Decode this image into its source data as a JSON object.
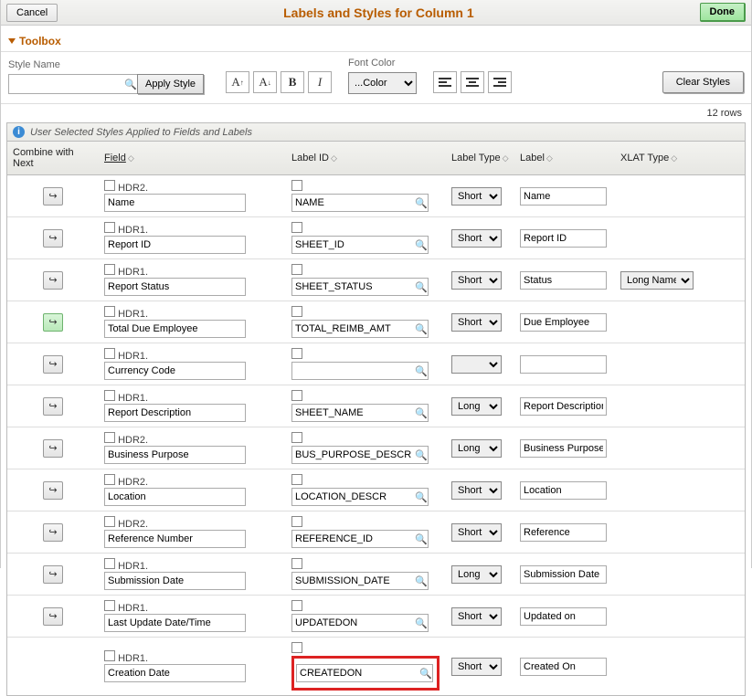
{
  "header": {
    "cancel": "Cancel",
    "title": "Labels and Styles for Column 1",
    "done": "Done"
  },
  "toolbox": {
    "title": "Toolbox",
    "style_name_label": "Style Name",
    "style_name_value": "",
    "apply_style": "Apply Style",
    "font_color_label": "Font Color",
    "font_color_value": "...Color",
    "clear_styles": "Clear Styles"
  },
  "row_count": "12 rows",
  "banner": "User Selected Styles Applied to Fields and Labels",
  "columns": {
    "combine": "Combine with Next",
    "field": "Field",
    "label_id": "Label ID",
    "label_type": "Label Type",
    "label": "Label",
    "xlat": "XLAT Type"
  },
  "rows": [
    {
      "hl": false,
      "hdr": "HDR2.",
      "field": "Name",
      "label_id": "NAME",
      "label_type": "Short",
      "label": "Name",
      "xlat": "",
      "highlight": false
    },
    {
      "hl": false,
      "hdr": "HDR1.",
      "field": "Report ID",
      "label_id": "SHEET_ID",
      "label_type": "Short",
      "label": "Report ID",
      "xlat": "",
      "highlight": false
    },
    {
      "hl": false,
      "hdr": "HDR1.",
      "field": "Report Status",
      "label_id": "SHEET_STATUS",
      "label_type": "Short",
      "label": "Status",
      "xlat": "Long Name",
      "highlight": false
    },
    {
      "hl": true,
      "hdr": "HDR1.",
      "field": "Total Due Employee",
      "label_id": "TOTAL_REIMB_AMT",
      "label_type": "Short",
      "label": "Due Employee",
      "xlat": "",
      "highlight": false
    },
    {
      "hl": false,
      "hdr": "HDR1.",
      "field": "Currency Code",
      "label_id": "",
      "label_type": "",
      "label": "",
      "xlat": "",
      "highlight": false
    },
    {
      "hl": false,
      "hdr": "HDR1.",
      "field": "Report Description",
      "label_id": "SHEET_NAME",
      "label_type": "Long",
      "label": "Report Description",
      "xlat": "",
      "highlight": false
    },
    {
      "hl": false,
      "hdr": "HDR2.",
      "field": "Business Purpose",
      "label_id": "BUS_PURPOSE_DESCR",
      "label_type": "Long",
      "label": "Business Purpose",
      "xlat": "",
      "highlight": false
    },
    {
      "hl": false,
      "hdr": "HDR2.",
      "field": "Location",
      "label_id": "LOCATION_DESCR",
      "label_type": "Short",
      "label": "Location",
      "xlat": "",
      "highlight": false
    },
    {
      "hl": false,
      "hdr": "HDR2.",
      "field": "Reference Number",
      "label_id": "REFERENCE_ID",
      "label_type": "Short",
      "label": "Reference",
      "xlat": "",
      "highlight": false
    },
    {
      "hl": false,
      "hdr": "HDR1.",
      "field": "Submission Date",
      "label_id": "SUBMISSION_DATE",
      "label_type": "Long",
      "label": "Submission Date",
      "xlat": "",
      "highlight": false
    },
    {
      "hl": false,
      "hdr": "HDR1.",
      "field": "Last Update Date/Time",
      "label_id": "UPDATEDON",
      "label_type": "Short",
      "label": "Updated on",
      "xlat": "",
      "highlight": false
    },
    {
      "hl": false,
      "hdr": "HDR1.",
      "field": "Creation Date",
      "label_id": "CREATEDON",
      "label_type": "Short",
      "label": "Created On",
      "xlat": "",
      "highlight": true,
      "no_combine": true
    }
  ]
}
